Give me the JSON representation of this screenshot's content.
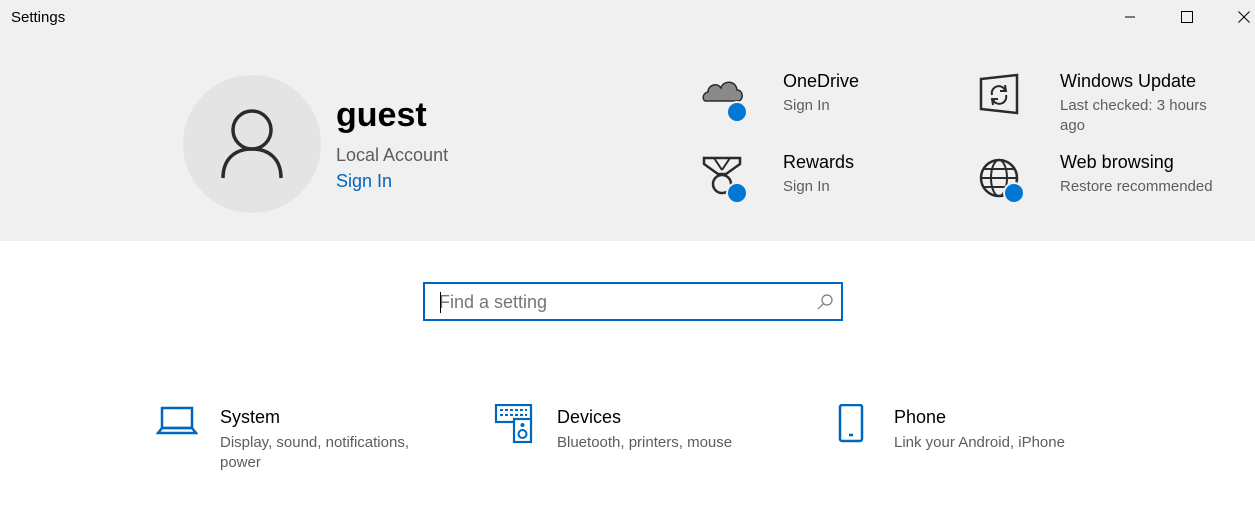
{
  "window": {
    "title": "Settings",
    "controls": [
      "minimize-icon",
      "maximize-icon",
      "close-icon"
    ]
  },
  "account": {
    "name": "guest",
    "type": "Local Account",
    "sign_in_label": "Sign In",
    "avatar_icon": "person-icon"
  },
  "services": {
    "onedrive": {
      "title": "OneDrive",
      "subtitle": "Sign In",
      "icon": "cloud-icon"
    },
    "rewards": {
      "title": "Rewards",
      "subtitle": "Sign In",
      "icon": "medal-icon"
    },
    "windows_update": {
      "title": "Windows Update",
      "subtitle": "Last checked: 3 hours ago",
      "icon": "update-icon"
    },
    "web_browsing": {
      "title": "Web browsing",
      "subtitle": "Restore recommended",
      "icon": "globe-icon"
    }
  },
  "search": {
    "placeholder": "Find a setting",
    "value": "",
    "icon": "search-icon"
  },
  "categories": {
    "system": {
      "title": "System",
      "subtitle": "Display, sound, notifications, power",
      "icon": "laptop-icon"
    },
    "devices": {
      "title": "Devices",
      "subtitle": "Bluetooth, printers, mouse",
      "icon": "devices-icon"
    },
    "phone": {
      "title": "Phone",
      "subtitle": "Link your Android, iPhone",
      "icon": "phone-icon"
    }
  },
  "colors": {
    "accent": "#0067c0",
    "status_dot": "#0078d4",
    "header_bg": "#f0f0f0",
    "secondary_text": "#5d5d5d"
  }
}
